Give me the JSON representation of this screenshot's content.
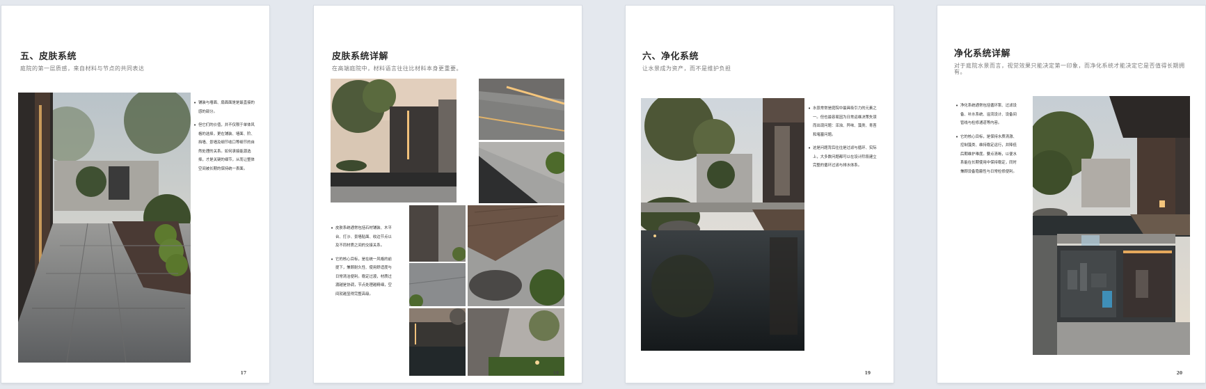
{
  "pages": [
    {
      "title": "五、皮肤系统",
      "subtitle": "庭院的第一层质感，来自材料与节点的共同表达",
      "bullets": [
        "铺装与墙面、扇面面是是最直接的感的部分。",
        "但它们的价值，并不仅限于单体风格的选择，更在铺装、墙面、阶、挡墙、景墙及细节收口等细节的自然处理的关系。如何承接能源选择，才是关键的细节，从而让整体空间被长期的保持统一表面。"
      ],
      "page_number": "17"
    },
    {
      "title": "皮肤系统详解",
      "subtitle": "在高端庭院中，材料语言往往比材料本身更重要。",
      "bullets": [
        "皮肤系统通常包括石材铺装、木平台、打沙、景墙贴面、收边节点以及不同材质之间的交接关系。",
        "它的核心目标，是在统一风格的前提下，兼顾耐久性、使用舒适度与日常清洁便利。稳定过渡，材质过渡越是协调，节点处理越精细，空间就越显得完整高级。"
      ],
      "page_number": "18"
    },
    {
      "title": "六、净化系统",
      "subtitle": "让水景成为资产，而不是维护负担",
      "bullets": [
        "水景常常是庭院中最具吸引力的元素之一。但也最容易因为日常运维决策失误而出现问题：浑浊、异味、藻类、青苔和堵塞问题。",
        "这是问题背后往往是过滤与循环、实际上，大多数问题都可以在设计阶段建立完整的循环过滤与排水体系。"
      ],
      "page_number": "19"
    },
    {
      "title": "净化系统详解",
      "subtitle": "对于庭院水景而言，视觉效果只能决定第一印象，而净化系统才能决定它是否值得长期拥有。",
      "bullets": [
        "净化系统通常包括循环泵、过滤设备、补水系统、溢流设计、设备间管线与检修通道等内容。",
        "它的核心目标，是保持水质清澈、控制藻类、维持稳定运行，并降低后期维护难度。要点清晰，以便水系能在长期使用中保持稳定，同时兼顾设备隐蔽性与日常检修便利。"
      ],
      "page_number": "20"
    }
  ]
}
